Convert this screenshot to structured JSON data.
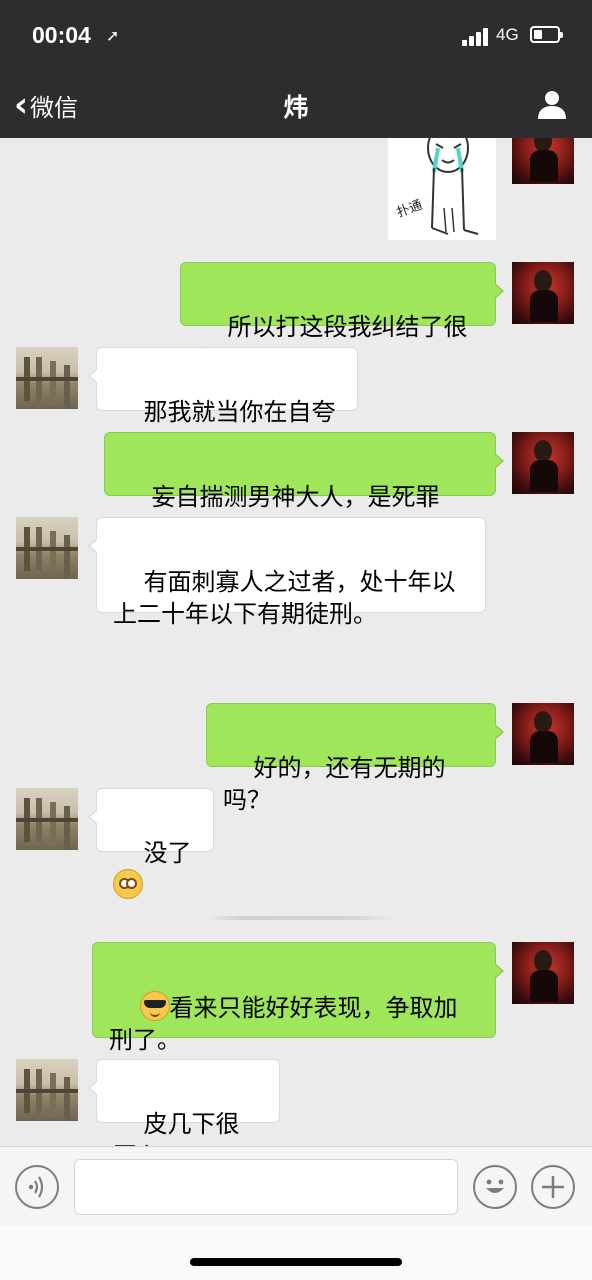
{
  "status_bar": {
    "time": "00:04",
    "network": "4G"
  },
  "nav": {
    "back_label": "微信",
    "title": "炜"
  },
  "sticker": {
    "caption": "扑通"
  },
  "messages": [
    {
      "side": "right",
      "text": "所以打这段我纠结了很久"
    },
    {
      "side": "left",
      "text": "那我就当你在自夸吧"
    },
    {
      "side": "right",
      "text": "妄自揣测男神大人，是死罪吗？"
    },
    {
      "side": "left",
      "text": "有面刺寡人之过者，处十年以上二十年以下有期徒刑。"
    },
    {
      "side": "right",
      "text": "好的，还有无期的吗？"
    },
    {
      "side": "left",
      "text": "没了",
      "emoji": "flushed-face-emoji"
    },
    {
      "side": "right",
      "text": "看来只能好好表现，争取加刑了。",
      "emoji": "sunglasses-face-emoji"
    },
    {
      "side": "left",
      "text": "皮几下很开心"
    }
  ],
  "input": {
    "placeholder": ""
  },
  "colors": {
    "bar": "#2d2d2d",
    "chat_bg": "#ebebeb",
    "bubble_me": "#9fe65a",
    "bubble_other": "#ffffff"
  }
}
